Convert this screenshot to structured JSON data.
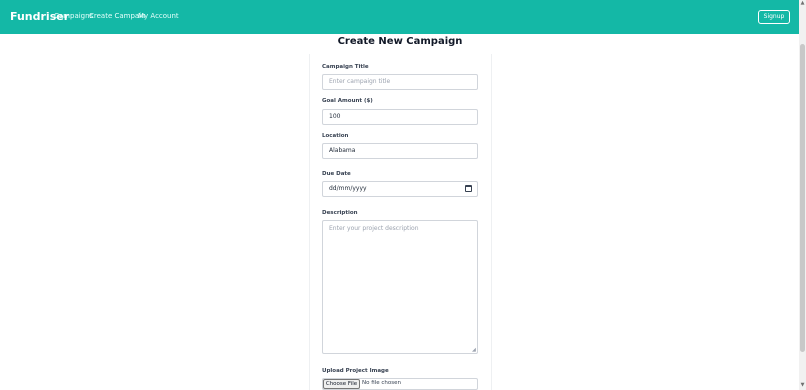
{
  "navbar": {
    "brand": "Fundriser",
    "links": [
      "Campaigns",
      "Create Campain",
      "My Account"
    ],
    "signup_label": "Signup",
    "color": "#14b8a6"
  },
  "form": {
    "title": "Create New Campaign",
    "campaign_title": {
      "label": "Campaign Title",
      "placeholder": "Enter campaign title",
      "value": ""
    },
    "goal_amount": {
      "label": "Goal Amount ($)",
      "value": "100"
    },
    "location": {
      "label": "Location",
      "value": "Alabama"
    },
    "due_date": {
      "label": "Due Date",
      "placeholder": "dd/mm/yyyy",
      "icon": "calendar-icon"
    },
    "description": {
      "label": "Description",
      "placeholder": "Enter your project description",
      "value": ""
    },
    "upload": {
      "label": "Upload Project Image",
      "button_label": "Choose File",
      "status": "No file chosen"
    }
  }
}
